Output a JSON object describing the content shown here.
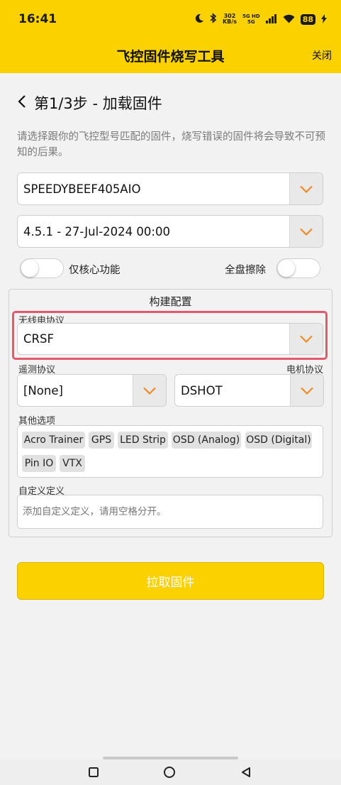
{
  "status_bar": {
    "time": "16:41",
    "speed_value": "302",
    "speed_unit": "KB/s",
    "network_top": "5G HD",
    "network_bottom": "5G",
    "battery": "88"
  },
  "app": {
    "title": "飞控固件烧写工具",
    "close_label": "关闭",
    "accent_color": "#fcd100"
  },
  "step": {
    "title": "第1/3步 - 加载固件",
    "description": "请选择跟你的飞控型号匹配的固件，烧写错误的固件将会导致不可预知的后果。"
  },
  "board_select": {
    "value": "SPEEDYBEEF405AIO"
  },
  "version_select": {
    "value": "4.5.1 - 27-Jul-2024 00:00"
  },
  "toggles": {
    "core_only": {
      "label": "仅核心功能",
      "checked": false
    },
    "full_erase": {
      "label": "全盘擦除",
      "checked": false
    }
  },
  "build": {
    "title": "构建配置",
    "radio_protocol": {
      "label": "无线电协议",
      "value": "CRSF"
    },
    "telemetry_protocol": {
      "label": "遥测协议",
      "value": "[None]"
    },
    "motor_protocol": {
      "label": "电机协议",
      "value": "DSHOT"
    },
    "other_options": {
      "label": "其他选项",
      "chips": [
        "Acro Trainer",
        "GPS",
        "LED Strip",
        "OSD (Analog)",
        "OSD (Digital)",
        "Pin IO",
        "VTX"
      ]
    },
    "custom_defines": {
      "label": "自定义定义",
      "placeholder": "添加自定义定义，请用空格分开。"
    }
  },
  "actions": {
    "pull_firmware": "拉取固件"
  },
  "nav_bar": {
    "icons": [
      "square-icon",
      "circle-icon",
      "back-triangle-icon"
    ]
  }
}
